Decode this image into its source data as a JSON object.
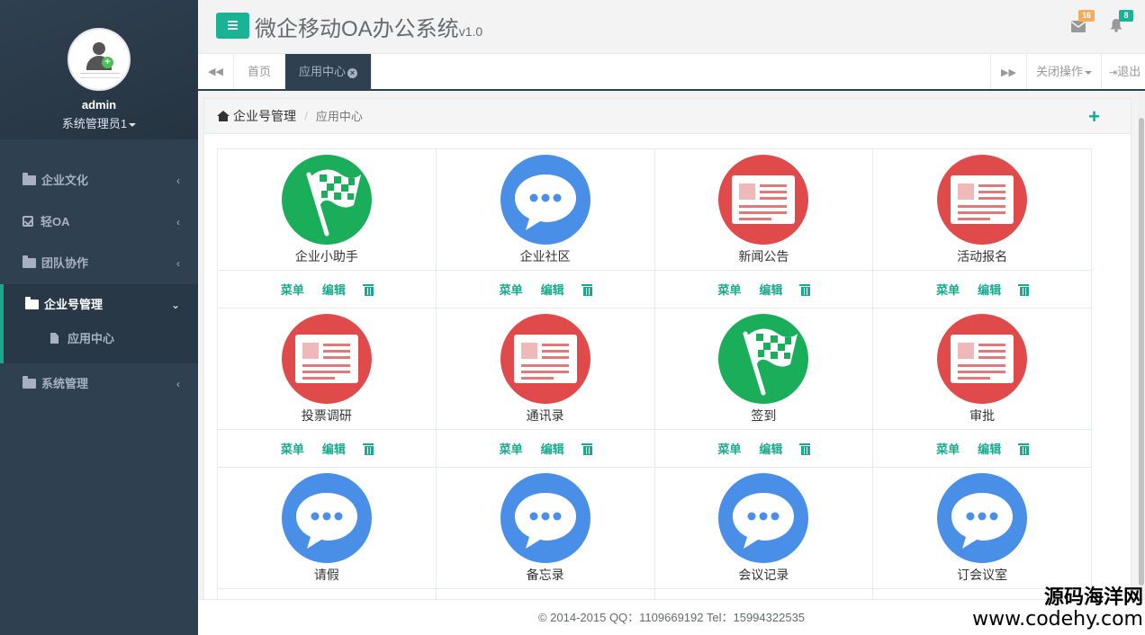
{
  "profile": {
    "username": "admin",
    "role": "系统管理员1"
  },
  "sidebar": {
    "items": [
      {
        "label": "企业文化",
        "icon": "folder-icon"
      },
      {
        "label": "轻OA",
        "icon": "check-square-icon"
      },
      {
        "label": "团队协作",
        "icon": "folder-icon"
      },
      {
        "label": "企业号管理",
        "icon": "folder-open-icon",
        "active": true
      },
      {
        "label": "系统管理",
        "icon": "folder-icon"
      }
    ],
    "sub_item": "应用中心"
  },
  "header": {
    "title": "微企移动OA办公系统",
    "version": "v1.0",
    "mail_badge": "16",
    "bell_badge": "8"
  },
  "tabs": {
    "home": "首页",
    "active": "应用中心",
    "close_ops": "关闭操作",
    "logout": "退出"
  },
  "breadcrumb": {
    "root": "企业号管理",
    "current": "应用中心"
  },
  "actions": {
    "menu": "菜单",
    "edit": "编辑"
  },
  "apps": [
    {
      "name": "企业小助手",
      "icon": "flag",
      "color": "#1aae5b"
    },
    {
      "name": "企业社区",
      "icon": "chat",
      "color": "#4a8fe7"
    },
    {
      "name": "新闻公告",
      "icon": "news",
      "color": "#e04a4a"
    },
    {
      "name": "活动报名",
      "icon": "news",
      "color": "#e04a4a"
    },
    {
      "name": "投票调研",
      "icon": "news",
      "color": "#e04a4a"
    },
    {
      "name": "通讯录",
      "icon": "news",
      "color": "#e04a4a"
    },
    {
      "name": "签到",
      "icon": "flag",
      "color": "#1aae5b"
    },
    {
      "name": "审批",
      "icon": "news",
      "color": "#e04a4a"
    },
    {
      "name": "请假",
      "icon": "chat",
      "color": "#4a8fe7"
    },
    {
      "name": "备忘录",
      "icon": "chat",
      "color": "#4a8fe7"
    },
    {
      "name": "会议记录",
      "icon": "chat",
      "color": "#4a8fe7"
    },
    {
      "name": "订会议室",
      "icon": "chat",
      "color": "#4a8fe7"
    }
  ],
  "footer": {
    "text": "© 2014-2015   QQ：1109669192   Tel：15994322535"
  },
  "watermark": {
    "cn": "源码海洋网",
    "url": "www.codehy.com"
  },
  "colors": {
    "accent": "#1ab394",
    "sidebar": "#2f4050",
    "action": "#19aa8d"
  }
}
